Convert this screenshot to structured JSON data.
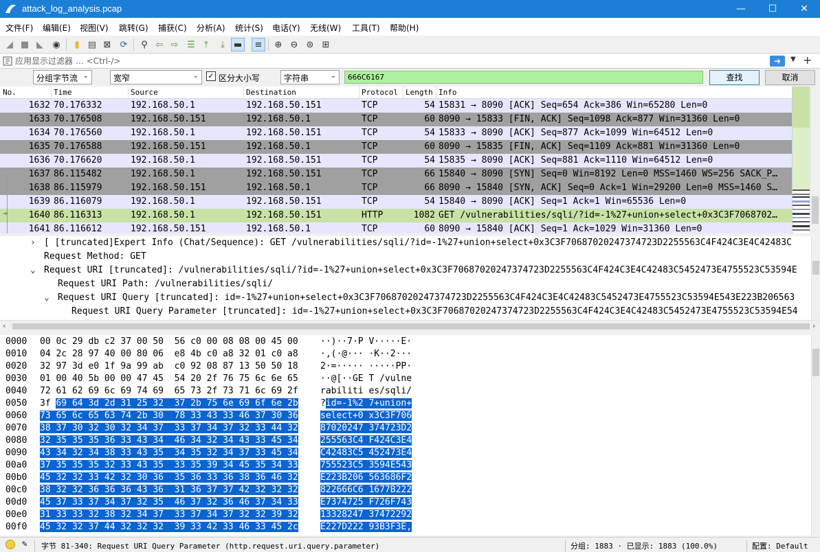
{
  "window": {
    "title": "attack_log_analysis.pcap",
    "controls": [
      "—",
      "☐",
      "✕"
    ]
  },
  "menu": [
    "文件(F)",
    "编辑(E)",
    "视图(V)",
    "跳转(G)",
    "捕获(C)",
    "分析(A)",
    "统计(S)",
    "电话(Y)",
    "无线(W)",
    "工具(T)",
    "帮助(H)"
  ],
  "filter": {
    "placeholder": "应用显示过滤器 … <Ctrl-/>",
    "value": ""
  },
  "find": {
    "search_in": "分组字节流",
    "char_width": "宽窄",
    "case_sensitive_label": "区分大小写",
    "case_sensitive_checked": true,
    "search_type": "字符串",
    "query": "666C6167",
    "find_button": "查找",
    "cancel_button": "取消"
  },
  "packet_list": {
    "columns": [
      "No.",
      "Time",
      "Source",
      "Destination",
      "Protocol",
      "Length",
      "Info"
    ],
    "rows": [
      {
        "no": "1632",
        "time": "70.176332",
        "src": "192.168.50.1",
        "dst": "192.168.50.151",
        "proto": "TCP",
        "len": "54",
        "info": "15831 → 8090 [ACK] Seq=654 Ack=386 Win=65280 Len=0",
        "style": "tcp"
      },
      {
        "no": "1633",
        "time": "70.176508",
        "src": "192.168.50.151",
        "dst": "192.168.50.1",
        "proto": "TCP",
        "len": "60",
        "info": "8090 → 15833 [FIN, ACK] Seq=1098 Ack=877 Win=31360 Len=0",
        "style": "fin"
      },
      {
        "no": "1634",
        "time": "70.176560",
        "src": "192.168.50.1",
        "dst": "192.168.50.151",
        "proto": "TCP",
        "len": "54",
        "info": "15833 → 8090 [ACK] Seq=877 Ack=1099 Win=64512 Len=0",
        "style": "tcp"
      },
      {
        "no": "1635",
        "time": "70.176588",
        "src": "192.168.50.151",
        "dst": "192.168.50.1",
        "proto": "TCP",
        "len": "60",
        "info": "8090 → 15835 [FIN, ACK] Seq=1109 Ack=881 Win=31360 Len=0",
        "style": "fin"
      },
      {
        "no": "1636",
        "time": "70.176620",
        "src": "192.168.50.1",
        "dst": "192.168.50.151",
        "proto": "TCP",
        "len": "54",
        "info": "15835 → 8090 [ACK] Seq=881 Ack=1110 Win=64512 Len=0",
        "style": "tcp"
      },
      {
        "no": "1637",
        "time": "86.115482",
        "src": "192.168.50.1",
        "dst": "192.168.50.151",
        "proto": "TCP",
        "len": "66",
        "info": "15840 → 8090 [SYN] Seq=0 Win=8192 Len=0 MSS=1460 WS=256 SACK_P…",
        "style": "fin"
      },
      {
        "no": "1638",
        "time": "86.115979",
        "src": "192.168.50.151",
        "dst": "192.168.50.1",
        "proto": "TCP",
        "len": "66",
        "info": "8090 → 15840 [SYN, ACK] Seq=0 Ack=1 Win=29200 Len=0 MSS=1460 S…",
        "style": "fin"
      },
      {
        "no": "1639",
        "time": "86.116079",
        "src": "192.168.50.1",
        "dst": "192.168.50.151",
        "proto": "TCP",
        "len": "54",
        "info": "15840 → 8090 [ACK] Seq=1 Ack=1 Win=65536 Len=0",
        "style": "tcp"
      },
      {
        "no": "1640",
        "time": "86.116313",
        "src": "192.168.50.1",
        "dst": "192.168.50.151",
        "proto": "HTTP",
        "len": "1082",
        "info": "GET /vulnerabilities/sqli/?id=-1%27+union+select+0x3C3F7068702…",
        "style": "http"
      },
      {
        "no": "1641",
        "time": "86.116612",
        "src": "192.168.50.151",
        "dst": "192.168.50.1",
        "proto": "TCP",
        "len": "60",
        "info": "8090 → 15840 [ACK] Seq=1 Ack=1029 Win=31360 Len=0",
        "style": "tcp"
      }
    ]
  },
  "details": [
    {
      "indent": 0,
      "twisty": "›",
      "text": "[ [truncated]Expert Info (Chat/Sequence): GET /vulnerabilities/sqli/?id=-1%27+union+select+0x3C3F70687020247374723D2255563C4F424C3E4C42483C"
    },
    {
      "indent": 0,
      "twisty": "",
      "text": "Request Method: GET"
    },
    {
      "indent": 0,
      "twisty": "⌄",
      "text": "Request URI [truncated]: /vulnerabilities/sqli/?id=-1%27+union+select+0x3C3F70687020247374723D2255563C4F424C3E4C42483C5452473E4755523C53594E"
    },
    {
      "indent": 1,
      "twisty": "",
      "text": "Request URI Path: /vulnerabilities/sqli/"
    },
    {
      "indent": 1,
      "twisty": "⌄",
      "text": "Request URI Query [truncated]: id=-1%27+union+select+0x3C3F70687020247374723D2255563C4F424C3E4C42483C5452473E4755523C53594E543E223B206563"
    },
    {
      "indent": 2,
      "twisty": "",
      "text": "Request URI Query Parameter [truncated]: id=-1%27+union+select+0x3C3F70687020247374723D2255563C4F424C3E4C42483C5452473E4755523C53594E54"
    }
  ],
  "bytes": [
    {
      "offset": "0000",
      "pre": "00 0c 29 db c2 37 00 50  56 c0 00 08 08 00 45 00",
      "hex": "",
      "apre": "··)··7·P V·····E·",
      "asc": ""
    },
    {
      "offset": "0010",
      "pre": "04 2c 28 97 40 00 80 06  e8 4b c0 a8 32 01 c0 a8",
      "hex": "",
      "apre": "·,(·@··· ·K··2···",
      "asc": ""
    },
    {
      "offset": "0020",
      "pre": "32 97 3d e0 1f 9a 99 ab  c0 92 08 87 13 50 50 18",
      "hex": "",
      "apre": "2·=····· ·····PP·",
      "asc": ""
    },
    {
      "offset": "0030",
      "pre": "01 00 40 5b 00 00 47 45  54 20 2f 76 75 6c 6e 65",
      "hex": "",
      "apre": "··@[··GE T /vulne",
      "asc": ""
    },
    {
      "offset": "0040",
      "pre": "72 61 62 69 6c 69 74 69  65 73 2f 73 71 6c 69 2f",
      "hex": "",
      "apre": "rabiliti es/sqli/",
      "asc": ""
    },
    {
      "offset": "0050",
      "pre": "3f ",
      "hex": "69 64 3d 2d 31 25 32  37 2b 75 6e 69 6f 6e 2b",
      "apre": "?",
      "asc": "id=-1%2 7+union+"
    },
    {
      "offset": "0060",
      "pre": "",
      "hex": "73 65 6c 65 63 74 2b 30  78 33 43 33 46 37 30 36",
      "apre": "",
      "asc": "select+0 x3C3F706"
    },
    {
      "offset": "0070",
      "pre": "",
      "hex": "38 37 30 32 30 32 34 37  33 37 34 37 32 33 44 32",
      "apre": "",
      "asc": "87020247 374723D2"
    },
    {
      "offset": "0080",
      "pre": "",
      "hex": "32 35 35 35 36 33 43 34  46 34 32 34 43 33 45 34",
      "apre": "",
      "asc": "255563C4 F424C3E4"
    },
    {
      "offset": "0090",
      "pre": "",
      "hex": "43 34 32 34 38 33 43 35  34 35 32 34 37 33 45 34",
      "apre": "",
      "asc": "C42483C5 452473E4"
    },
    {
      "offset": "00a0",
      "pre": "",
      "hex": "37 35 35 35 32 33 43 35  33 35 39 34 45 35 34 33",
      "apre": "",
      "asc": "755523C5 3594E543"
    },
    {
      "offset": "00b0",
      "pre": "",
      "hex": "45 32 32 33 42 32 30 36  35 36 33 36 38 36 46 32",
      "apre": "",
      "asc": "E223B206 563686F2"
    },
    {
      "offset": "00c0",
      "pre": "",
      "hex": "38 32 32 36 36 36 43 36  31 36 37 37 42 32 32 32",
      "apre": "",
      "asc": "822666C6 1677B222"
    },
    {
      "offset": "00d0",
      "pre": "",
      "hex": "45 37 33 37 34 37 32 35  46 37 32 36 46 37 34 33",
      "apre": "",
      "asc": "E7374725 F726F743"
    },
    {
      "offset": "00e0",
      "pre": "",
      "hex": "31 33 33 32 38 32 34 37  33 37 34 37 32 32 39 32",
      "apre": "",
      "asc": "13328247 37472292"
    },
    {
      "offset": "00f0",
      "pre": "",
      "hex": "45 32 32 37 44 32 32 32  39 33 42 33 46 33 45 2c",
      "apre": "",
      "asc": "E227D222 93B3F3E,"
    }
  ],
  "status": {
    "field": "字节 81-340: Request URI Query Parameter (http.request.uri.query.parameter)",
    "packets": "分组: 1883 · 已显示: 1883 (100.0%)",
    "profile": "配置: Default"
  },
  "colors": {
    "titlebar": "#1c7fd6",
    "tcp_row": "#e7e6ff",
    "fin_row": "#a0a0a0",
    "http_row": "#c8e2a6",
    "highlight": "#0a64d2",
    "find_input": "#aef0a0"
  }
}
